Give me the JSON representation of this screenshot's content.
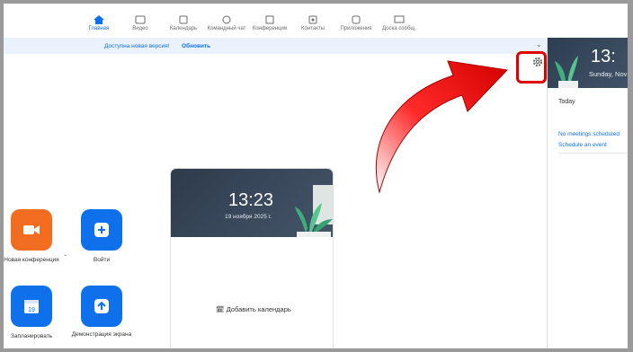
{
  "nav": {
    "items": [
      {
        "label": "Главная",
        "icon": "home-icon"
      },
      {
        "label": "Видео",
        "icon": "video-icon"
      },
      {
        "label": "Календарь",
        "icon": "calendar-icon"
      },
      {
        "label": "Командный чат",
        "icon": "chat-icon"
      },
      {
        "label": "Конференции",
        "icon": "meetings-icon"
      },
      {
        "label": "Контакты",
        "icon": "contacts-icon"
      },
      {
        "label": "Приложения",
        "icon": "apps-icon"
      },
      {
        "label": "Доска сообщ.",
        "icon": "whiteboard-icon"
      }
    ],
    "active_index": 0
  },
  "banner": {
    "text": "Доступна новая версия!",
    "link": "Обновить"
  },
  "actions": [
    {
      "label": "Новая конференция",
      "icon": "camera-icon",
      "color": "#f26d21"
    },
    {
      "label": "Войти",
      "icon": "plus-icon",
      "color": "#0e71eb"
    },
    {
      "label": "Запланировать",
      "icon": "calendar-19-icon",
      "color": "#0e71eb",
      "badge": "19"
    },
    {
      "label": "Демонстрация экрана",
      "icon": "share-screen-icon",
      "color": "#0e71eb"
    }
  ],
  "card": {
    "time": "13:23",
    "date": "19 ноября 2025 г.",
    "add_calendar": "Добавить календарь"
  },
  "right_panel": {
    "time": "13:",
    "date": "Sunday, Nov",
    "today": "Today",
    "no_meetings": "No meetings scheduled",
    "schedule_event": "Schedule an event"
  },
  "colors": {
    "accent": "#0e71eb",
    "orange": "#f26d21",
    "highlight": "#e00000"
  }
}
